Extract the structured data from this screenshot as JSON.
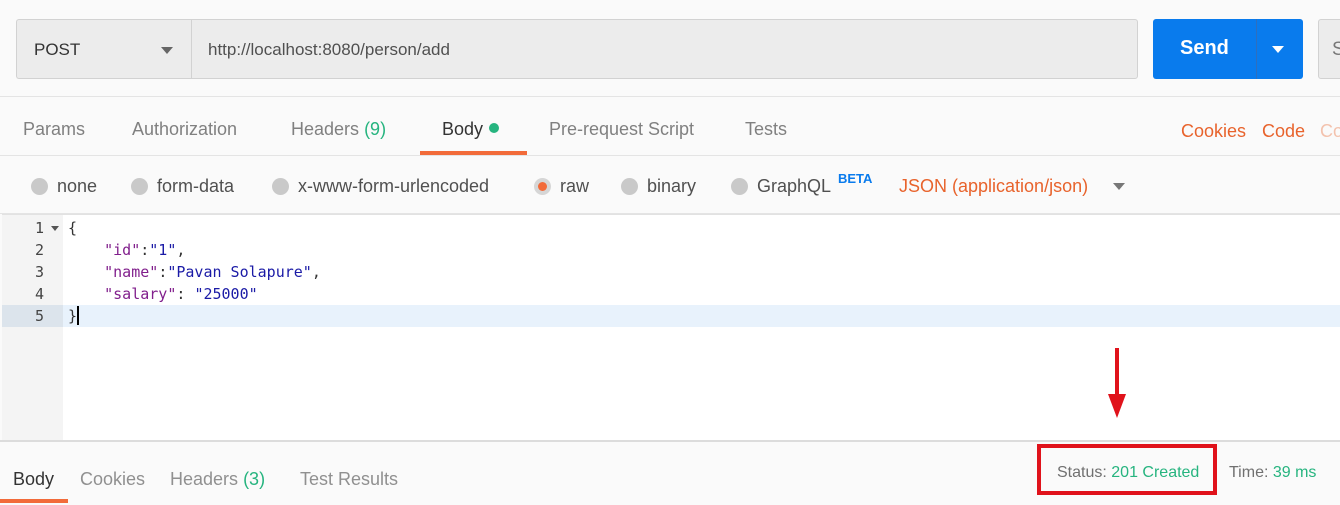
{
  "request": {
    "method": "POST",
    "url": "http://localhost:8080/person/add",
    "send_label": "Send",
    "save_label": "S"
  },
  "request_tabs": [
    {
      "label": "Params"
    },
    {
      "label": "Authorization"
    },
    {
      "label": "Headers",
      "count": "(9)"
    },
    {
      "label": "Body",
      "active": true
    },
    {
      "label": "Pre-request Script"
    },
    {
      "label": "Tests"
    }
  ],
  "right_links": {
    "cookies": "Cookies",
    "code": "Code",
    "comments": "Co"
  },
  "body_types": [
    {
      "label": "none"
    },
    {
      "label": "form-data"
    },
    {
      "label": "x-www-form-urlencoded"
    },
    {
      "label": "raw",
      "selected": true
    },
    {
      "label": "binary"
    },
    {
      "label": "GraphQL",
      "badge": "BETA"
    }
  ],
  "content_type": "JSON (application/json)",
  "editor": {
    "lines": [
      {
        "n": "1",
        "text": "{"
      },
      {
        "n": "2",
        "key": "\"id\"",
        "sep": ":",
        "value": "\"1\"",
        "end": ","
      },
      {
        "n": "3",
        "key": "\"name\"",
        "sep": ":",
        "value": "\"Pavan Solapure\"",
        "end": ","
      },
      {
        "n": "4",
        "key": "\"salary\"",
        "sep": ": ",
        "value": "\"25000\"",
        "end": ""
      },
      {
        "n": "5",
        "text": "}"
      }
    ]
  },
  "response": {
    "tabs": [
      {
        "label": "Body",
        "active": true
      },
      {
        "label": "Cookies"
      },
      {
        "label": "Headers",
        "count": "(3)"
      },
      {
        "label": "Test Results"
      }
    ],
    "status_label": "Status:",
    "status_value": "201 Created",
    "time_label": "Time:",
    "time_value": "39 ms"
  },
  "colors": {
    "accent_orange": "#f26b3a",
    "send_blue": "#097bed",
    "status_green": "#26b47f",
    "annotation_red": "#e0121b"
  }
}
